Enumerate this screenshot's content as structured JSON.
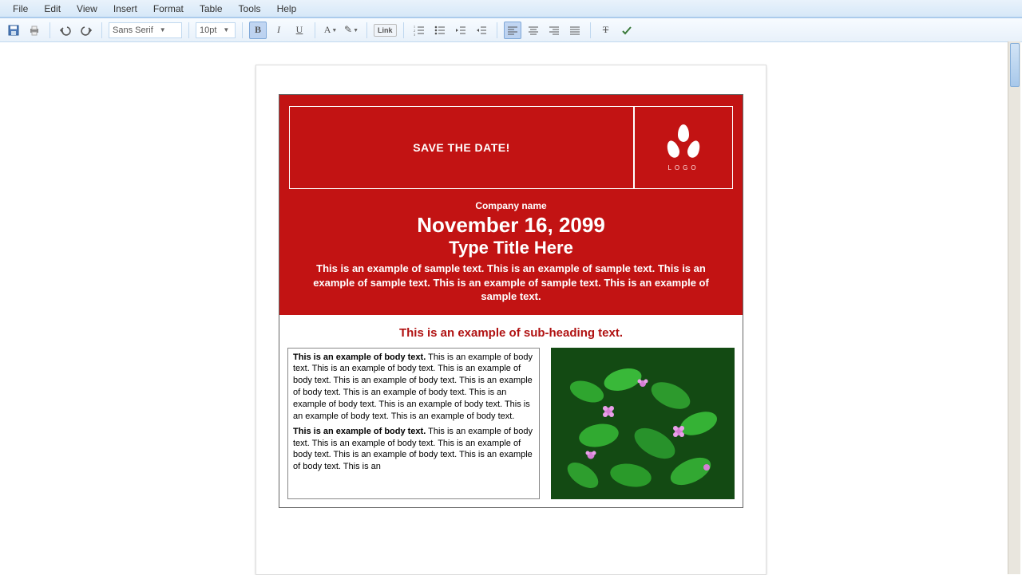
{
  "menu": {
    "file": "File",
    "edit": "Edit",
    "view": "View",
    "insert": "Insert",
    "format": "Format",
    "table": "Table",
    "tools": "Tools",
    "help": "Help"
  },
  "toolbar": {
    "font_name": "Sans Serif",
    "font_size": "10pt",
    "bold": "B",
    "italic": "I",
    "underline": "U",
    "text_color": "A",
    "highlight": "✎",
    "link_label": "Link",
    "strike": "T"
  },
  "doc": {
    "save_the_date": "SAVE THE DATE!",
    "logo_text": "LOGO",
    "company": "Company name",
    "date": "November 16, 2099",
    "title": "Type Title Here",
    "sample": "This is an example of sample text. This is an example of sample text. This is an example of sample text. This is an example of sample text. This is an example of sample text.",
    "subheading": "This is an example of sub-heading text.",
    "body_lead": "This is an example of body text.",
    "body_tail": " This is an example of body text. This is an example of body text. This is an example of body text. This is an example of body text. This is an example of body text. This is an example of body text. This is an example of body text. This is an example of body text. This is an example of body text. This is an example of body text.",
    "body2_tail": " This is an example of body text. This is an example of body text. This is an example of body text. This is an example of body text. This is an example of body text. This is an"
  }
}
